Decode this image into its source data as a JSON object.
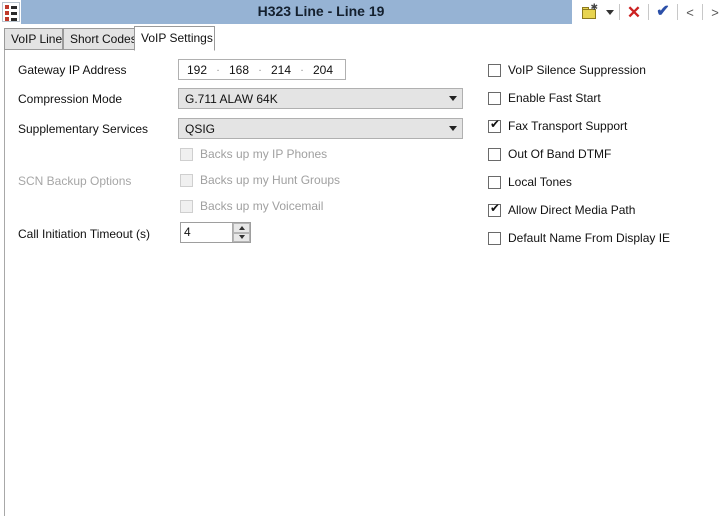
{
  "window": {
    "title": "H323 Line - Line 19",
    "menu_icon": "list-menu-icon"
  },
  "titlebar_tools": [
    {
      "name": "new-folder-button",
      "icon": "folder-new-icon",
      "label": ""
    },
    {
      "name": "new-folder-dropdown",
      "icon": "caret-down-icon",
      "label": ""
    },
    {
      "name": "cancel-button",
      "icon": "red-x-icon",
      "label": "✕"
    },
    {
      "name": "ok-button",
      "icon": "blue-check-icon",
      "label": "✔"
    },
    {
      "name": "previous-button",
      "icon": "chevron-left-icon",
      "label": "<"
    },
    {
      "name": "next-button",
      "icon": "chevron-right-icon",
      "label": ">"
    }
  ],
  "tabs": [
    {
      "label": "VoIP Line",
      "active": false
    },
    {
      "label": "Short Codes",
      "active": false
    },
    {
      "label": "VoIP Settings",
      "active": true
    }
  ],
  "form": {
    "gateway_ip": {
      "label": "Gateway IP Address",
      "octets": [
        "192",
        "168",
        "214",
        "204"
      ],
      "separator": "."
    },
    "compression_mode": {
      "label": "Compression Mode",
      "value": "G.711 ALAW 64K"
    },
    "supplementary_services": {
      "label": "Supplementary Services",
      "value": "QSIG"
    },
    "scn_backup": {
      "label": "SCN Backup Options",
      "disabled": true,
      "options": [
        {
          "label": "Backs up my IP Phones",
          "checked": false,
          "disabled": true
        },
        {
          "label": "Backs up my Hunt Groups",
          "checked": false,
          "disabled": true
        },
        {
          "label": "Backs up my Voicemail",
          "checked": false,
          "disabled": true
        }
      ]
    },
    "call_initiation_timeout": {
      "label": "Call Initiation Timeout (s)",
      "value": "4"
    }
  },
  "right_options": [
    {
      "label": "VoIP Silence Suppression",
      "checked": false
    },
    {
      "label": "Enable Fast Start",
      "checked": false
    },
    {
      "label": "Fax Transport Support",
      "checked": true
    },
    {
      "label": "Out Of Band DTMF",
      "checked": false
    },
    {
      "label": "Local Tones",
      "checked": false
    },
    {
      "label": "Allow Direct Media Path",
      "checked": true
    },
    {
      "label": "Default Name From Display IE",
      "checked": false
    }
  ],
  "colors": {
    "titlebar": "#96b3d4",
    "panel_background": "#ffffff",
    "tab_inactive": "#e3e3e3",
    "combo_background": "#e4e4e4",
    "accent_ok": "#2b4fa8",
    "accent_cancel": "#cc2222"
  },
  "checkmark_glyph": "✔"
}
